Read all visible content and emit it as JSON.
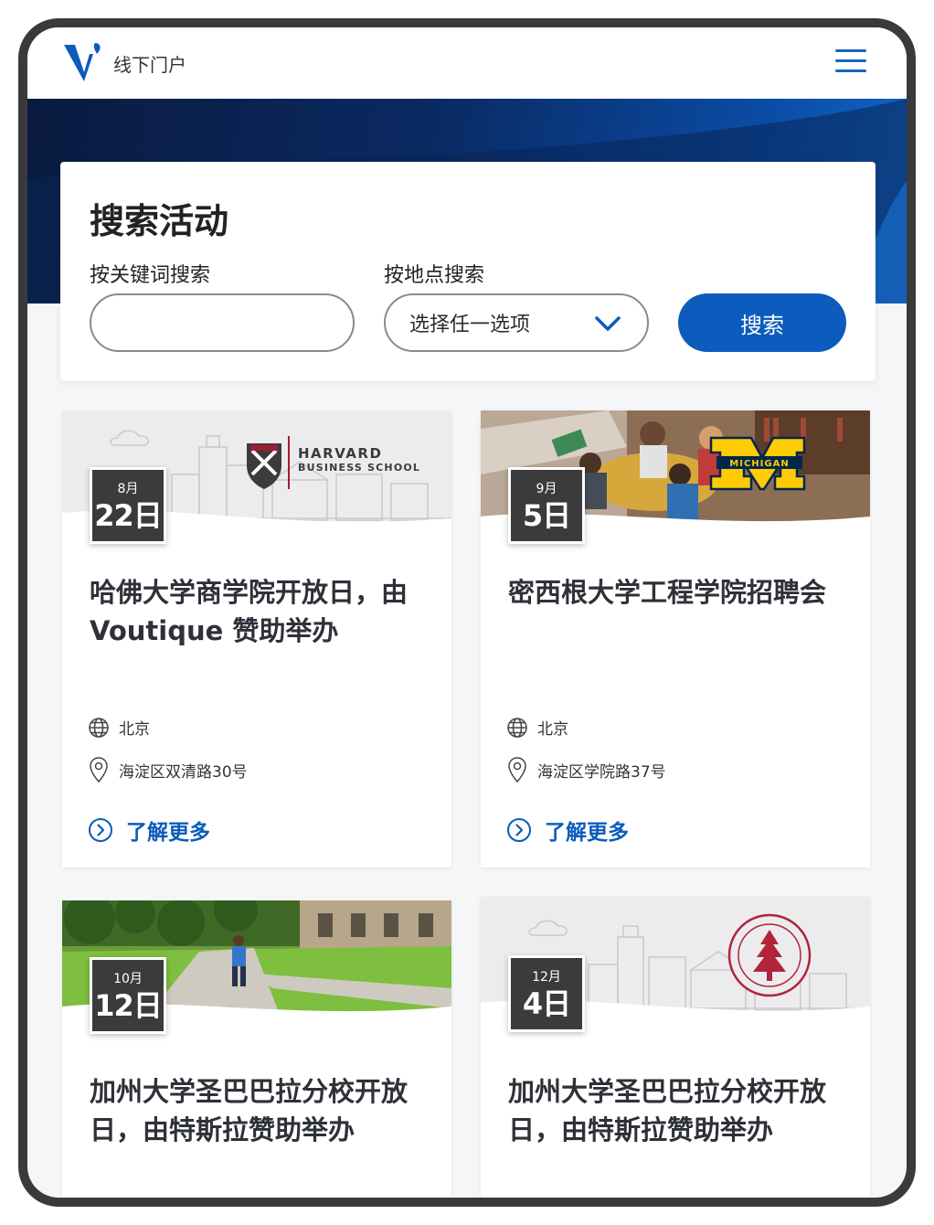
{
  "header": {
    "portal_name": "线下门户",
    "logo_icon": "v-logo-icon",
    "menu_icon": "hamburger-menu-icon"
  },
  "colors": {
    "brand_blue": "#0b5cbc",
    "hero_dark": "#0a1a3e",
    "date_box": "#3b3b3d"
  },
  "search": {
    "title": "搜索活动",
    "keyword_label": "按关键词搜索",
    "keyword_value": "",
    "location_label": "按地点搜索",
    "location_selected": "选择任一选项",
    "button_label": "搜索"
  },
  "events": [
    {
      "month": "8月",
      "day": "22日",
      "title_line1": "哈佛大学商学院开放日，由",
      "title_line2": "Voutique 赞助举办",
      "city": "北京",
      "address": "海淀区双清路30号",
      "link": "了解更多",
      "image_logo_line1": "HARVARD",
      "image_logo_line2": "BUSINESS SCHOOL"
    },
    {
      "month": "9月",
      "day": "5日",
      "title_line1": "密西根大学工程学院招聘会",
      "title_line2": "",
      "city": "北京",
      "address": "海淀区学院路37号",
      "link": "了解更多",
      "image_logo_line1": "MICHIGAN"
    },
    {
      "month": "10月",
      "day": "12日",
      "title_line1": "加州大学圣巴巴拉分校开放",
      "title_line2": "日，由特斯拉赞助举办"
    },
    {
      "month": "12月",
      "day": "4日",
      "title_line1": "加州大学圣巴巴拉分校开放",
      "title_line2": "日，由特斯拉赞助举办"
    }
  ]
}
